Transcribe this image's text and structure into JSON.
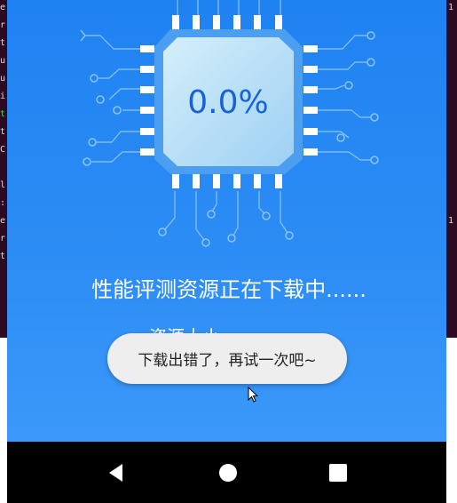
{
  "terminal": {
    "left_chars": [
      "e",
      "r",
      "t",
      "u",
      "u",
      "i",
      "t",
      "t",
      "C",
      "",
      "l",
      ":",
      "e",
      "r",
      "t"
    ],
    "left_green_index": 6,
    "right_chars": [
      "1",
      "",
      "",
      "",
      "",
      "",
      "",
      "",
      "",
      "",
      "",
      "",
      "1",
      "",
      ""
    ]
  },
  "app": {
    "progress_text": "0.0%",
    "status_text": "性能评测资源正在下载中......",
    "size_text": "资源大小",
    "toast_text": "下载出错了，再试一次吧~"
  },
  "colors": {
    "background_top": "#1f82f1",
    "background_bottom": "#3c98fa",
    "chip_border": "#4c9ff0",
    "chip_face": "#bfe3f8",
    "progress_text": "#1762d6",
    "circuit_line": "#8cc4f8",
    "toast_bg": "#eeeeee"
  },
  "icons": {
    "cursor": "mouse-pointer-icon",
    "nav_back": "back-triangle-icon",
    "nav_home": "home-circle-icon",
    "nav_recent": "recent-apps-square-icon"
  }
}
